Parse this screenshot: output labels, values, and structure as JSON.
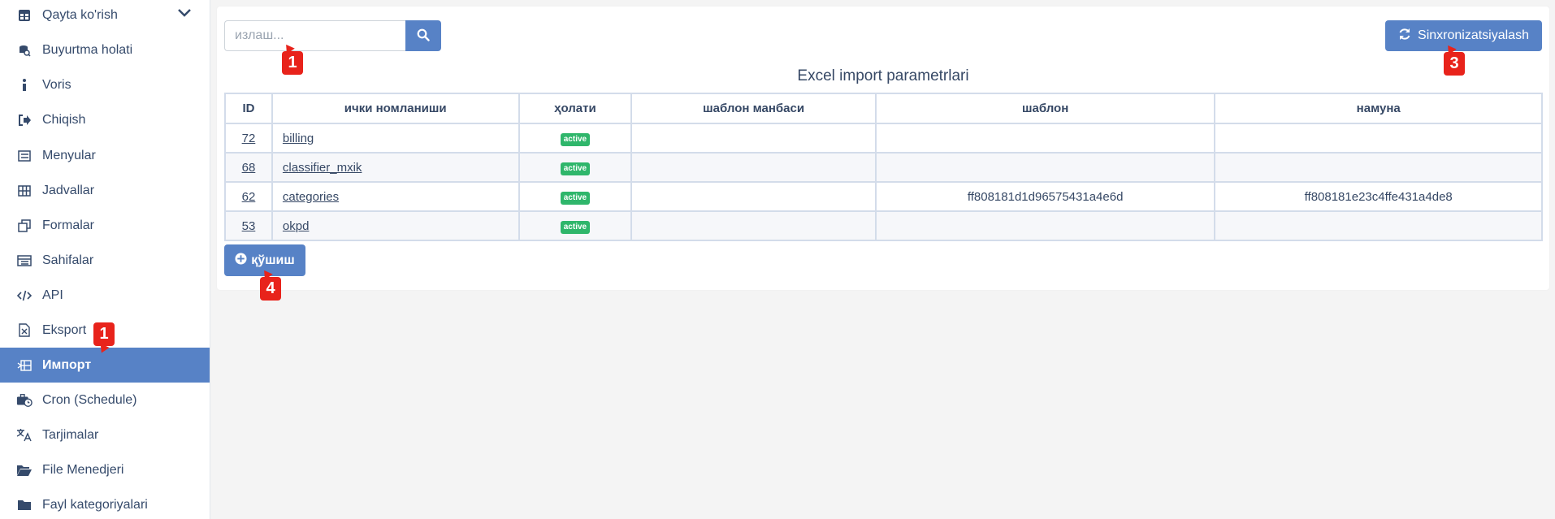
{
  "sidebar": {
    "items": [
      {
        "label": "Qayta ko'rish",
        "icon": "table-icon"
      },
      {
        "label": "Buyurtma holati",
        "icon": "search-database-icon"
      },
      {
        "label": "Voris",
        "icon": "info-icon"
      },
      {
        "label": "Chiqish",
        "icon": "sign-out-icon"
      },
      {
        "label": "Menyular",
        "icon": "list-icon"
      },
      {
        "label": "Jadvallar",
        "icon": "grid-icon"
      },
      {
        "label": "Formalar",
        "icon": "clone-icon"
      },
      {
        "label": "Sahifalar",
        "icon": "rows-icon"
      },
      {
        "label": "API",
        "icon": "code-icon"
      },
      {
        "label": "Eksport",
        "icon": "file-excel-icon"
      },
      {
        "label": "Импорт",
        "icon": "file-import-icon"
      },
      {
        "label": "Cron (Schedule)",
        "icon": "briefcase-clock-icon"
      },
      {
        "label": "Tarjimalar",
        "icon": "translate-icon"
      },
      {
        "label": "File Menedjeri",
        "icon": "folder-open-icon"
      },
      {
        "label": "Fayl kategoriyalari",
        "icon": "folder-icon"
      }
    ],
    "active_index": 10
  },
  "search": {
    "placeholder": "излаш..."
  },
  "sync_button": {
    "label": "Sinxronizatsiyalash"
  },
  "table": {
    "title": "Excel import parametrlari",
    "columns": [
      "ID",
      "ички номланиши",
      "ҳолати",
      "шаблон манбаси",
      "шаблон",
      "намуна"
    ],
    "rows": [
      {
        "id": "72",
        "name": "billing",
        "status": "active",
        "source": "",
        "template": "",
        "sample": ""
      },
      {
        "id": "68",
        "name": "classifier_mxik",
        "status": "active",
        "source": "",
        "template": "",
        "sample": ""
      },
      {
        "id": "62",
        "name": "categories",
        "status": "active",
        "source": "",
        "template": "ff808181d1d96575431a4e6d",
        "sample": "ff808181e23c4ffe431a4de8"
      },
      {
        "id": "53",
        "name": "okpd",
        "status": "active",
        "source": "",
        "template": "",
        "sample": ""
      }
    ]
  },
  "add_button": {
    "label": "қўшиш"
  },
  "markers": [
    "1",
    "1",
    "3",
    "4"
  ],
  "colors": {
    "accent": "#5782c6",
    "badge": "#2fb66b",
    "marker": "#e8231b"
  }
}
